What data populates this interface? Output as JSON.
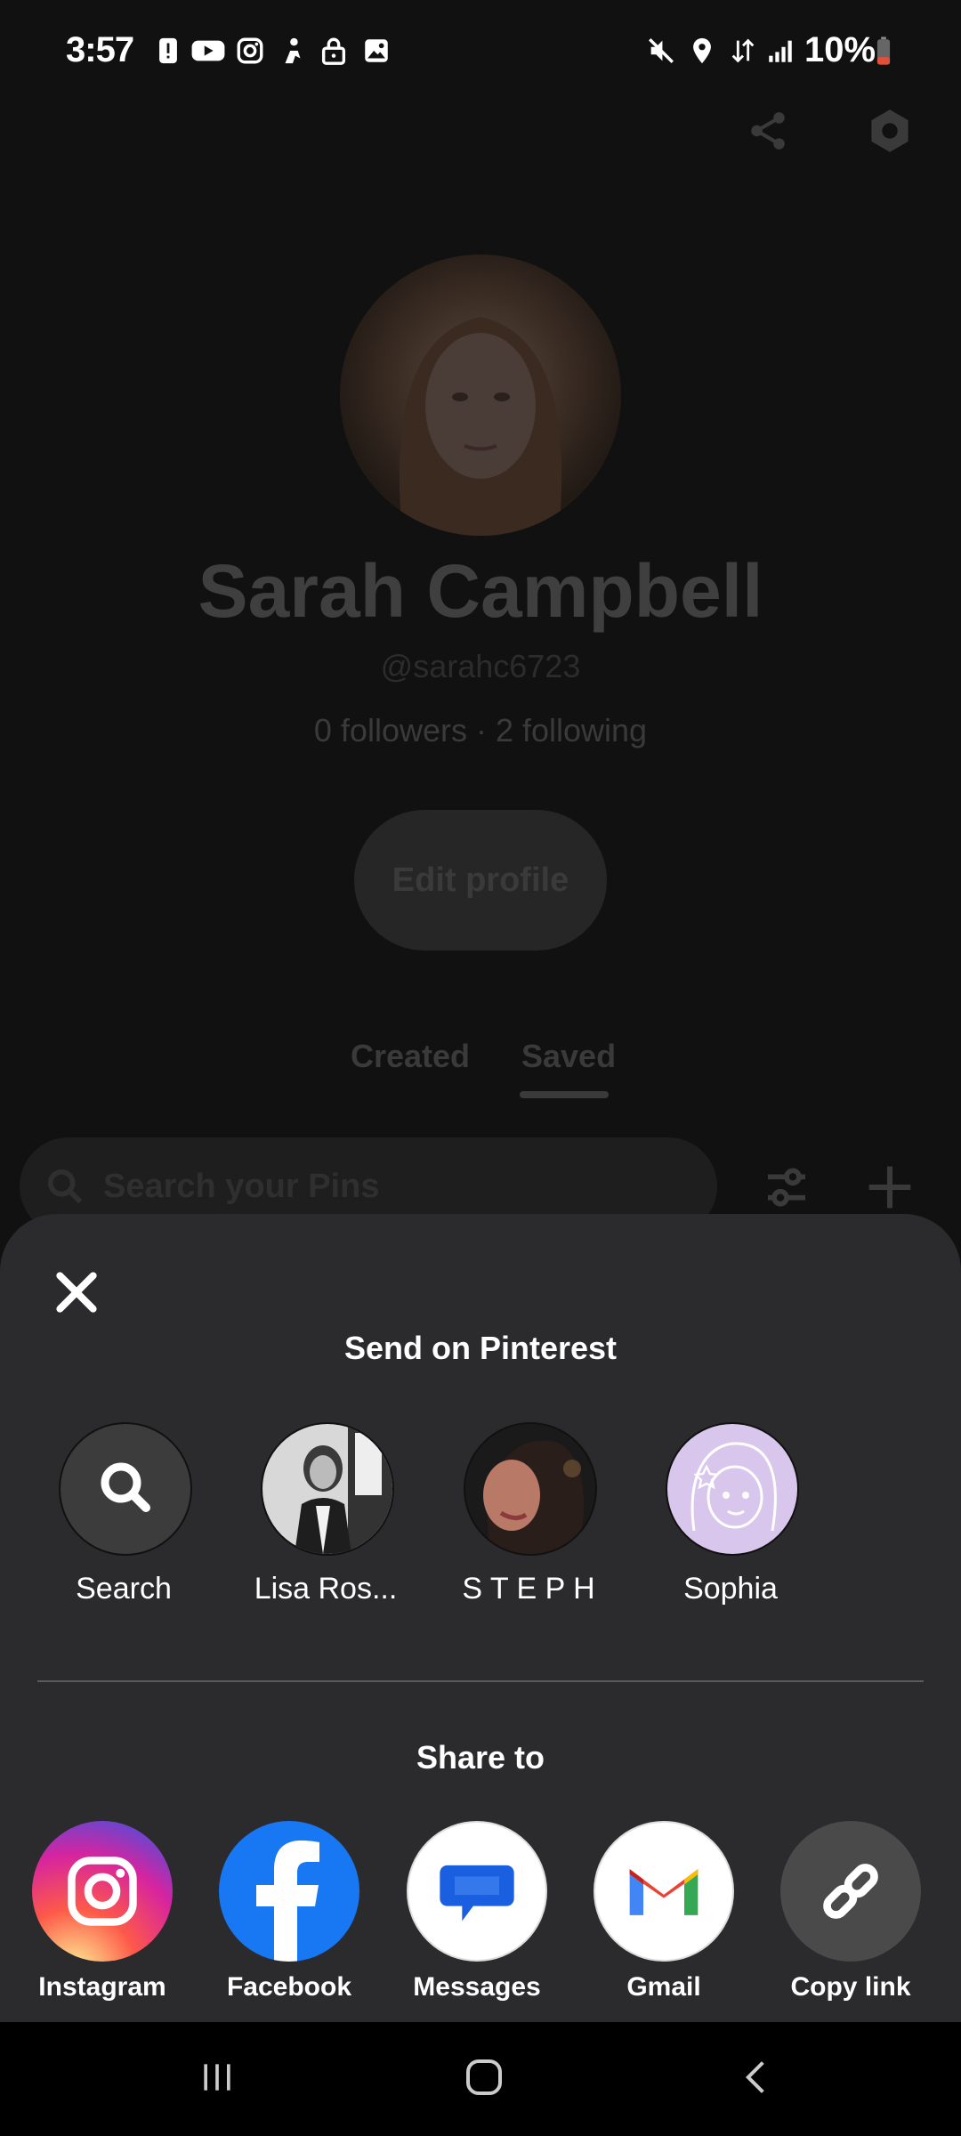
{
  "status_bar": {
    "time": "3:57",
    "battery": "10%",
    "icons": [
      "alert-icon",
      "youtube-icon",
      "instagram-icon",
      "person-icon",
      "lock-icon",
      "image-icon",
      "mute-icon",
      "location-icon",
      "data-icon",
      "signal-icon",
      "battery-icon"
    ]
  },
  "profile": {
    "name": "Sarah Campbell",
    "handle": "@sarahc6723",
    "follows": "0 followers · 2 following",
    "edit_label": "Edit profile",
    "tabs": [
      "Created",
      "Saved"
    ],
    "active_tab": "Saved",
    "search_placeholder": "Search your Pins"
  },
  "sheet": {
    "send_title": "Send on Pinterest",
    "contacts": [
      {
        "label": "Search"
      },
      {
        "label": "Lisa Ros..."
      },
      {
        "label": "S T E P H"
      },
      {
        "label": "Sophia"
      }
    ],
    "share_title": "Share to",
    "apps": [
      {
        "label": "Instagram"
      },
      {
        "label": "Facebook"
      },
      {
        "label": "Messages"
      },
      {
        "label": "Gmail"
      },
      {
        "label": "Copy link"
      }
    ]
  },
  "colors": {
    "sheet_bg": "#2b2b2d",
    "facebook": "#1877f2",
    "messages": "#1a5fe0"
  }
}
